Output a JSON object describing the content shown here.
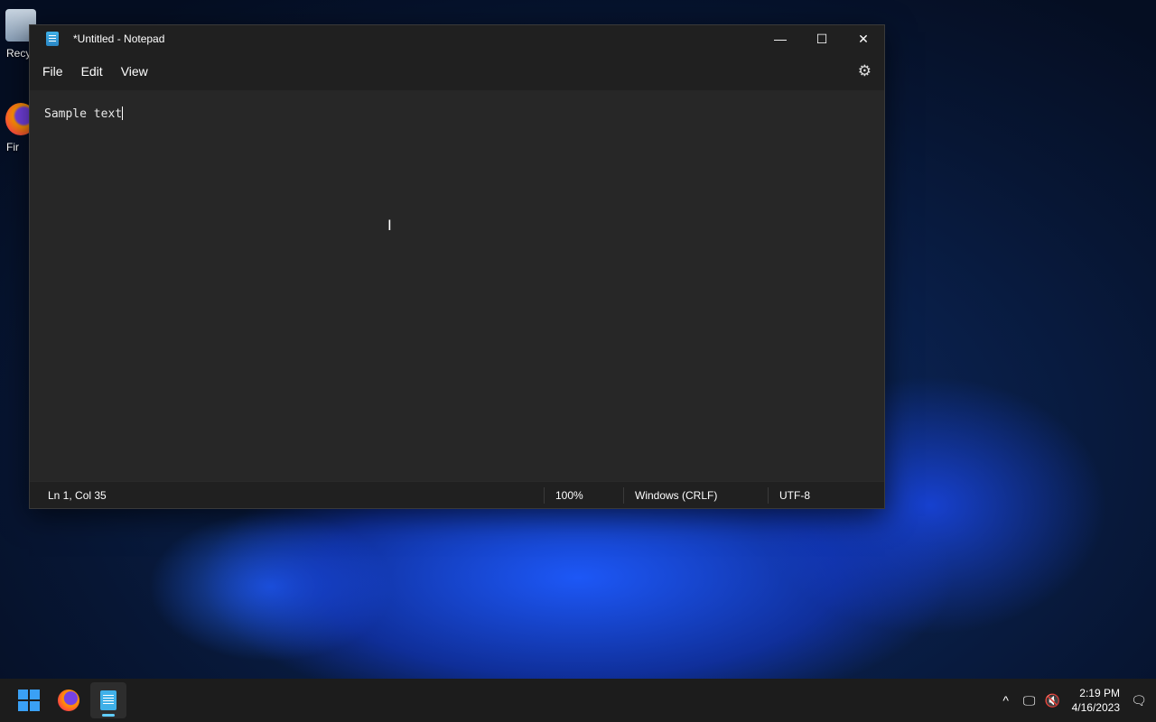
{
  "desktop": {
    "icons": [
      {
        "label": "Recy"
      },
      {
        "label": "Fir"
      }
    ]
  },
  "window": {
    "title": "*Untitled - Notepad",
    "controls": {
      "minimize": "—",
      "maximize": "☐",
      "close": "✕"
    },
    "menu": [
      {
        "label": "File"
      },
      {
        "label": "Edit"
      },
      {
        "label": "View"
      }
    ],
    "settings_glyph": "⚙",
    "editor": {
      "text": "Sample text"
    },
    "status": {
      "position": "Ln 1, Col 35",
      "zoom": "100%",
      "line_ending": "Windows (CRLF)",
      "encoding": "UTF-8"
    }
  },
  "taskbar": {
    "tray": {
      "chevron": "^",
      "network": "🖵",
      "volume": "🔇",
      "notifications": "🗨"
    },
    "time": "2:19 PM",
    "date": "4/16/2023"
  },
  "colors": {
    "accent": "#60cdff",
    "window_bg": "#202020",
    "editor_bg": "#272727"
  }
}
